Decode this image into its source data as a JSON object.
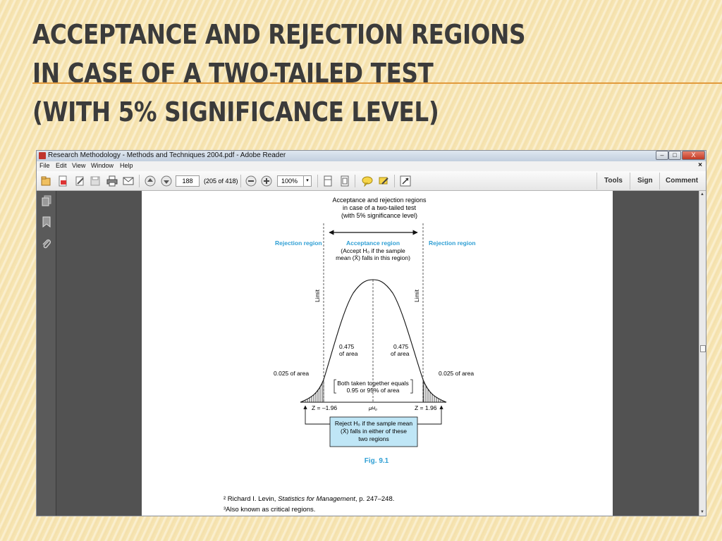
{
  "slide": {
    "title_lines": [
      "ACCEPTANCE AND REJECTION REGIONS",
      "IN CASE OF A TWO-TAILED TEST",
      "(WITH 5% SIGNIFICANCE LEVEL)"
    ]
  },
  "window": {
    "title": "Research Methodology - Methods and Techniques 2004.pdf - Adobe Reader",
    "buttons": {
      "minimize": "–",
      "maximize": "□",
      "close": "X"
    }
  },
  "menubar": {
    "items": [
      "File",
      "Edit",
      "View",
      "Window",
      "Help"
    ],
    "close": "×"
  },
  "toolbar": {
    "page_number": "188",
    "page_of": "(205 of 418)",
    "zoom": "100%",
    "zoom_arrow": "▾",
    "tools": "Tools",
    "sign": "Sign",
    "comment": "Comment"
  },
  "figure": {
    "heading": [
      "Acceptance and rejection regions",
      "in case of a two-tailed test",
      "(with 5% significance level)"
    ],
    "rejection_left": "Rejection region",
    "rejection_right": "Rejection region",
    "acceptance_title": "Acceptance region",
    "acceptance_lines": [
      "(Accept H₀ if the sample",
      "mean (X̄) falls in this region)"
    ],
    "limit_left": "Limit",
    "limit_right": "Limit",
    "area_left": [
      "0.475",
      "of area"
    ],
    "area_right": [
      "0.475",
      "of area"
    ],
    "tail_left": "0.025 of area",
    "tail_right": "0.025 of area",
    "both_together": [
      "Both taken together equals",
      "0.95 or 95% of area"
    ],
    "z_left": "Z = –1.96",
    "z_right": "Z = 1.96",
    "mu": "μH₀",
    "reject_box": [
      "Reject H₀ if the sample mean",
      "(X̄) falls in either of these",
      "two regions"
    ],
    "fig_label": "Fig. 9.1"
  },
  "footnotes": {
    "note1_prefix": "² Richard I. Levin, ",
    "note1_title": "Statistics for Management",
    "note1_suffix": ", p. 247–248.",
    "note2": "³Also known as critical regions."
  },
  "colors": {
    "accent_blue": "#2f9fd4",
    "title_rule": "#e29a3c",
    "reject_box_fill": "#bfe6f6"
  }
}
